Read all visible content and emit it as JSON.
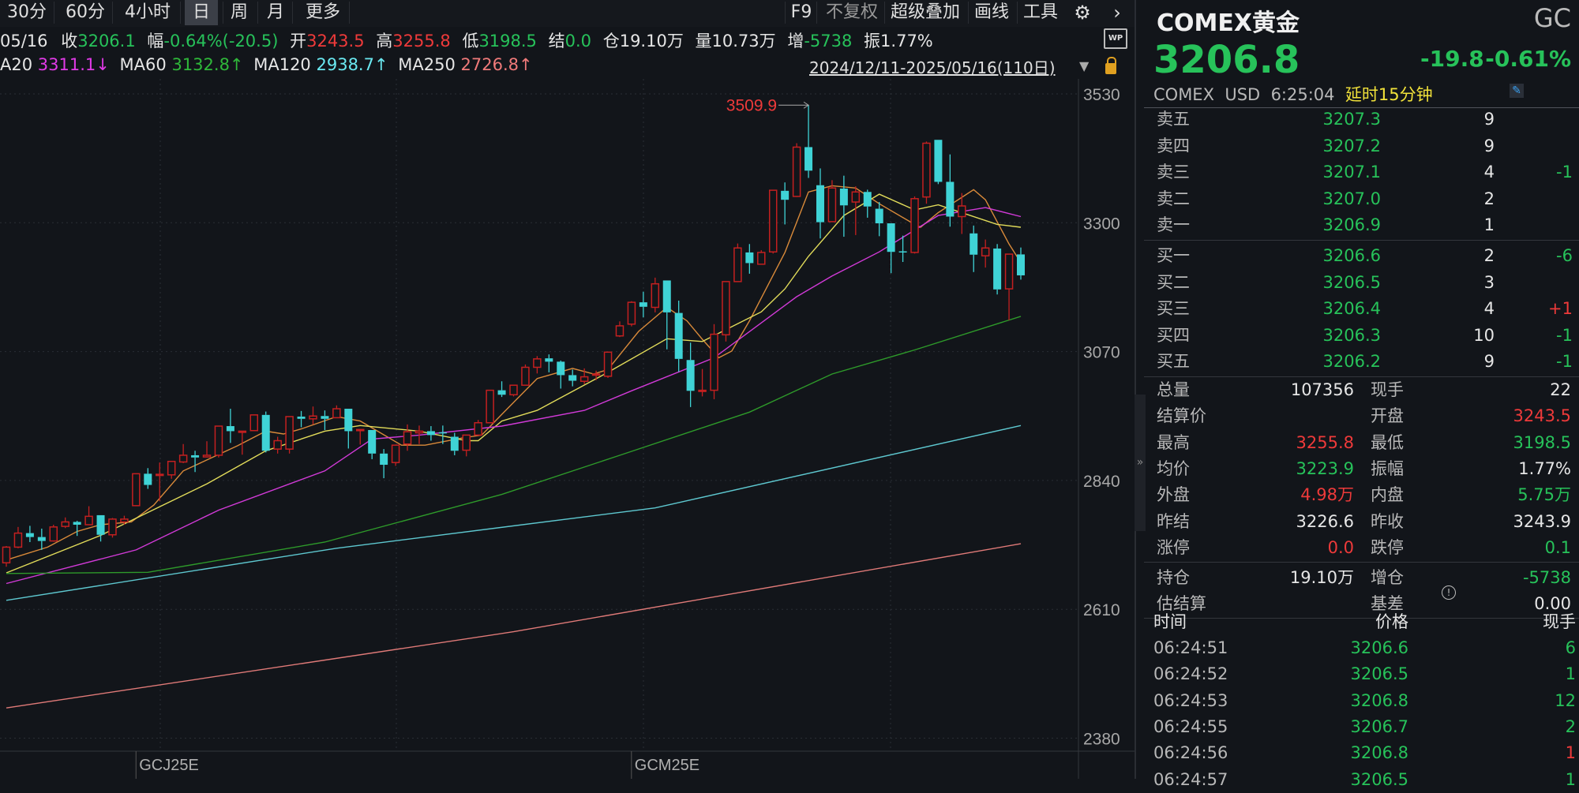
{
  "toolbar": {
    "periods": [
      "30分",
      "60分",
      "4小时",
      "日",
      "周",
      "月",
      "更多"
    ],
    "selected": "日",
    "right_items": [
      "F9",
      "不复权",
      "超级叠加",
      "画线",
      "工具"
    ],
    "gear_icon": "gear-icon",
    "next_icon": "chevron-right-icon"
  },
  "info": {
    "date": "05/16",
    "close_label": "收",
    "close": "3206.1",
    "chg_label": "幅",
    "chg": "-0.64%(-20.5)",
    "open_label": "开",
    "open": "3243.5",
    "high_label": "高",
    "high": "3255.8",
    "low_label": "低",
    "low": "3198.5",
    "settle_label": "结",
    "settle": "0.0",
    "oi": "仓19.10万",
    "vol": "量10.73万",
    "inc_label": "增",
    "inc": "-5738",
    "amp": "振1.77%"
  },
  "ma_row": {
    "ma20_label": "A20",
    "ma20": "3311.1↓",
    "ma60_label": "MA60",
    "ma60": "3132.8↑",
    "ma120_label": "MA120",
    "ma120": "2938.7↑",
    "ma250_label": "MA250",
    "ma250": "2726.8↑",
    "range": "2024/12/11-2025/05/16(110日)"
  },
  "colors": {
    "up": "#c42020",
    "down": "#3fd3d6",
    "green": "#27c25a",
    "red": "#ee3a3a",
    "ma5": "#d98a3a",
    "ma10": "#e2dc5a",
    "ma20": "#d23ad8",
    "ma60": "#2e9a2a",
    "ma120": "#5ec8d0",
    "ma250": "#e07a78"
  },
  "chart_data": {
    "type": "candlestick",
    "ylim": [
      2380,
      3530
    ],
    "yticks": [
      "3530",
      "3300",
      "3070",
      "2840",
      "2610",
      "2380"
    ],
    "xlabels": [
      {
        "text": "GCJ25E",
        "index": 13
      },
      {
        "text": "GCM25E",
        "index": 55
      }
    ],
    "max_label": "3509.9",
    "max_index": 68,
    "candles": [
      [
        2693,
        2723,
        2686,
        2721
      ],
      [
        2721,
        2757,
        2719,
        2746
      ],
      [
        2746,
        2759,
        2730,
        2739
      ],
      [
        2739,
        2754,
        2716,
        2732
      ],
      [
        2732,
        2761,
        2731,
        2757
      ],
      [
        2758,
        2774,
        2755,
        2766
      ],
      [
        2766,
        2768,
        2741,
        2761
      ],
      [
        2761,
        2794,
        2761,
        2776
      ],
      [
        2778,
        2778,
        2731,
        2743
      ],
      [
        2743,
        2773,
        2738,
        2771
      ],
      [
        2766,
        2777,
        2761,
        2771
      ],
      [
        2795,
        2852,
        2794,
        2852
      ],
      [
        2852,
        2862,
        2825,
        2832
      ],
      [
        2849,
        2872,
        2803,
        2851
      ],
      [
        2850,
        2875,
        2843,
        2874
      ],
      [
        2873,
        2905,
        2871,
        2885
      ],
      [
        2885,
        2893,
        2855,
        2881
      ],
      [
        2882,
        2910,
        2881,
        2885
      ],
      [
        2885,
        2937,
        2881,
        2937
      ],
      [
        2937,
        2968,
        2907,
        2928
      ],
      [
        2926,
        2928,
        2886,
        2928
      ],
      [
        2929,
        2957,
        2929,
        2957
      ],
      [
        2957,
        2963,
        2890,
        2893
      ],
      [
        2896,
        2918,
        2888,
        2911
      ],
      [
        2896,
        2954,
        2888,
        2954
      ],
      [
        2954,
        2964,
        2935,
        2950
      ],
      [
        2950,
        2972,
        2940,
        2955
      ],
      [
        2955,
        2965,
        2930,
        2950
      ],
      [
        2952,
        2974,
        2952,
        2968
      ],
      [
        2968,
        2968,
        2897,
        2928
      ],
      [
        2930,
        2931,
        2904,
        2931
      ],
      [
        2930,
        2930,
        2878,
        2888
      ],
      [
        2888,
        2896,
        2844,
        2868
      ],
      [
        2872,
        2903,
        2866,
        2903
      ],
      [
        2905,
        2940,
        2893,
        2927
      ],
      [
        2925,
        2938,
        2905,
        2928
      ],
      [
        2928,
        2937,
        2911,
        2921
      ],
      [
        2926,
        2938,
        2905,
        2925
      ],
      [
        2918,
        2925,
        2885,
        2893
      ],
      [
        2894,
        2921,
        2883,
        2921
      ],
      [
        2921,
        2948,
        2921,
        2943
      ],
      [
        2943,
        3001,
        2943,
        3001
      ],
      [
        3001,
        3017,
        2989,
        2993
      ],
      [
        2993,
        3010,
        2990,
        3010
      ],
      [
        3010,
        3047,
        3010,
        3042
      ],
      [
        3042,
        3062,
        3031,
        3057
      ],
      [
        3058,
        3065,
        3033,
        3052
      ],
      [
        3052,
        3054,
        3004,
        3028
      ],
      [
        3028,
        3038,
        3008,
        3018
      ],
      [
        3017,
        3040,
        3012,
        3025
      ],
      [
        3029,
        3036,
        3019,
        3030
      ],
      [
        3026,
        3070,
        3023,
        3069
      ],
      [
        3098,
        3124,
        3096,
        3116
      ],
      [
        3119,
        3160,
        3115,
        3158
      ],
      [
        3158,
        3177,
        3131,
        3150
      ],
      [
        3149,
        3202,
        3140,
        3191
      ],
      [
        3197,
        3197,
        3074,
        3140
      ],
      [
        3139,
        3161,
        3034,
        3057
      ],
      [
        3055,
        3086,
        2971,
        3000
      ],
      [
        2999,
        3039,
        2990,
        3001
      ],
      [
        3001,
        3119,
        2985,
        3101
      ],
      [
        3100,
        3195,
        3088,
        3195
      ],
      [
        3195,
        3263,
        3195,
        3255
      ],
      [
        3247,
        3262,
        3209,
        3228
      ],
      [
        3226,
        3251,
        3226,
        3247
      ],
      [
        3248,
        3358,
        3245,
        3358
      ],
      [
        3357,
        3372,
        3297,
        3341
      ],
      [
        3347,
        3442,
        3346,
        3435
      ],
      [
        3435,
        3509.9,
        3380,
        3393
      ],
      [
        3367,
        3397,
        3272,
        3301
      ],
      [
        3302,
        3376,
        3301,
        3362
      ],
      [
        3361,
        3384,
        3275,
        3331
      ],
      [
        3337,
        3365,
        3278,
        3355
      ],
      [
        3355,
        3359,
        3309,
        3329
      ],
      [
        3325,
        3337,
        3276,
        3299
      ],
      [
        3299,
        3299,
        3210,
        3248
      ],
      [
        3249,
        3277,
        3230,
        3247
      ],
      [
        3247,
        3347,
        3245,
        3343
      ],
      [
        3346,
        3445,
        3334,
        3442
      ],
      [
        3448,
        3448,
        3369,
        3373
      ],
      [
        3373,
        3422,
        3293,
        3311
      ],
      [
        3311,
        3353,
        3280,
        3330
      ],
      [
        3281,
        3295,
        3212,
        3243
      ],
      [
        3241,
        3270,
        3220,
        3255
      ],
      [
        3254,
        3262,
        3172,
        3181
      ],
      [
        3182,
        3244,
        3126,
        3244
      ],
      [
        3243.5,
        3255.8,
        3198.5,
        3206.1
      ]
    ],
    "ma_series": [
      {
        "name": "MA5",
        "color_key": "ma5",
        "points": [
          [
            0,
            2698
          ],
          [
            3.5,
            2721
          ],
          [
            6,
            2749
          ],
          [
            8,
            2761
          ],
          [
            10.6,
            2766
          ],
          [
            12.5,
            2796
          ],
          [
            15,
            2857
          ],
          [
            19.6,
            2902
          ],
          [
            22,
            2928
          ],
          [
            23.5,
            2923
          ],
          [
            25,
            2932
          ],
          [
            28,
            2954
          ],
          [
            30,
            2946
          ],
          [
            33.5,
            2903
          ],
          [
            35.5,
            2903
          ],
          [
            38.7,
            2916
          ],
          [
            40.3,
            2921
          ],
          [
            42,
            2958
          ],
          [
            45,
            3022
          ],
          [
            48,
            3040
          ],
          [
            49.8,
            3030
          ],
          [
            51,
            3038
          ],
          [
            53.6,
            3106
          ],
          [
            56,
            3149
          ],
          [
            57.7,
            3125
          ],
          [
            59,
            3092
          ],
          [
            60.4,
            3059
          ],
          [
            61.5,
            3071
          ],
          [
            63,
            3125
          ],
          [
            66,
            3247
          ],
          [
            68,
            3355
          ],
          [
            70,
            3366
          ],
          [
            72,
            3362
          ],
          [
            74,
            3334
          ],
          [
            77,
            3297
          ],
          [
            77.5,
            3292
          ],
          [
            79,
            3318
          ],
          [
            82,
            3359
          ],
          [
            83,
            3341
          ],
          [
            85,
            3262
          ],
          [
            86,
            3229
          ]
        ]
      },
      {
        "name": "MA10",
        "color_key": "ma10",
        "points": [
          [
            0,
            2675
          ],
          [
            8,
            2742
          ],
          [
            17,
            2834
          ],
          [
            22,
            2893
          ],
          [
            27,
            2928
          ],
          [
            30,
            2938
          ],
          [
            35,
            2928
          ],
          [
            39,
            2911
          ],
          [
            40,
            2911
          ],
          [
            42,
            2946
          ],
          [
            45,
            2965
          ],
          [
            51,
            3033
          ],
          [
            56,
            3093
          ],
          [
            59,
            3088
          ],
          [
            64,
            3141
          ],
          [
            66,
            3182
          ],
          [
            68,
            3240
          ],
          [
            71,
            3313
          ],
          [
            74,
            3351
          ],
          [
            77,
            3323
          ],
          [
            79,
            3332
          ],
          [
            84,
            3297
          ],
          [
            86,
            3292
          ]
        ]
      },
      {
        "name": "MA20",
        "color_key": "ma20",
        "points": [
          [
            0,
            2656
          ],
          [
            11,
            2716
          ],
          [
            18,
            2787
          ],
          [
            27,
            2857
          ],
          [
            31,
            2914
          ],
          [
            35,
            2921
          ],
          [
            42,
            2937
          ],
          [
            49,
            2965
          ],
          [
            53,
            3000
          ],
          [
            60,
            3059
          ],
          [
            67,
            3168
          ],
          [
            70,
            3205
          ],
          [
            74,
            3248
          ],
          [
            79,
            3313
          ],
          [
            83,
            3327
          ],
          [
            86,
            3311
          ]
        ]
      },
      {
        "name": "MA60",
        "color_key": "ma60",
        "points": [
          [
            0,
            2674
          ],
          [
            12,
            2676
          ],
          [
            27,
            2730
          ],
          [
            42,
            2815
          ],
          [
            52,
            2885
          ],
          [
            63,
            2962
          ],
          [
            70,
            3030
          ],
          [
            77,
            3073
          ],
          [
            86,
            3133
          ]
        ]
      },
      {
        "name": "MA120",
        "color_key": "ma120",
        "points": [
          [
            0,
            2626
          ],
          [
            28,
            2719
          ],
          [
            55,
            2791
          ],
          [
            86,
            2938
          ]
        ]
      },
      {
        "name": "MA250",
        "color_key": "ma250",
        "points": [
          [
            0,
            2434
          ],
          [
            43,
            2570
          ],
          [
            86,
            2727
          ]
        ]
      }
    ]
  },
  "panel": {
    "name": "COMEX黄金",
    "code": "GC",
    "price": "3206.8",
    "change": "-19.8",
    "pct": "-0.61%",
    "exchange": "COMEX",
    "currency": "USD",
    "time": "6:25:04",
    "delay": "延时15分钟",
    "asks": [
      {
        "label": "卖五",
        "price": "3207.3",
        "qty": "9",
        "chg": ""
      },
      {
        "label": "卖四",
        "price": "3207.2",
        "qty": "9",
        "chg": ""
      },
      {
        "label": "卖三",
        "price": "3207.1",
        "qty": "4",
        "chg": "-1"
      },
      {
        "label": "卖二",
        "price": "3207.0",
        "qty": "2",
        "chg": ""
      },
      {
        "label": "卖一",
        "price": "3206.9",
        "qty": "1",
        "chg": ""
      }
    ],
    "bids": [
      {
        "label": "买一",
        "price": "3206.6",
        "qty": "2",
        "chg": "-6"
      },
      {
        "label": "买二",
        "price": "3206.5",
        "qty": "3",
        "chg": ""
      },
      {
        "label": "买三",
        "price": "3206.4",
        "qty": "4",
        "chg": "+1"
      },
      {
        "label": "买四",
        "price": "3206.3",
        "qty": "10",
        "chg": "-1"
      },
      {
        "label": "买五",
        "price": "3206.2",
        "qty": "9",
        "chg": "-1"
      }
    ],
    "stats": [
      {
        "l1": "总量",
        "v1": "107356",
        "c1": "w",
        "l2": "现手",
        "v2": "22",
        "c2": "w"
      },
      {
        "l1": "结算价",
        "v1": "",
        "c1": "w",
        "l2": "开盘",
        "v2": "3243.5",
        "c2": "r"
      },
      {
        "l1": "最高",
        "v1": "3255.8",
        "c1": "r",
        "l2": "最低",
        "v2": "3198.5",
        "c2": "g"
      },
      {
        "l1": "均价",
        "v1": "3223.9",
        "c1": "g",
        "l2": "振幅",
        "v2": "1.77%",
        "c2": "w"
      },
      {
        "l1": "外盘",
        "v1": "4.98万",
        "c1": "r",
        "l2": "内盘",
        "v2": "5.75万",
        "c2": "g"
      },
      {
        "l1": "昨结",
        "v1": "3226.6",
        "c1": "w",
        "l2": "昨收",
        "v2": "3243.9",
        "c2": "w"
      },
      {
        "l1": "涨停",
        "v1": "0.0",
        "c1": "r",
        "l2": "跌停",
        "v2": "0.1",
        "c2": "g"
      }
    ],
    "stats2": [
      {
        "l1": "持仓",
        "v1": "19.10万",
        "c1": "w",
        "l2": "增仓",
        "v2": "-5738",
        "c2": "g"
      },
      {
        "l1": "估结算",
        "v1": "",
        "c1": "w",
        "l2": "基差",
        "v2": "0.00",
        "c2": "w"
      }
    ],
    "trade_header": {
      "time": "时间",
      "price": "价格",
      "qty": "现手"
    },
    "trades": [
      {
        "time": "06:24:51",
        "price": "3206.6",
        "qty": "6",
        "c": "g"
      },
      {
        "time": "06:24:52",
        "price": "3206.5",
        "qty": "1",
        "c": "g"
      },
      {
        "time": "06:24:53",
        "price": "3206.8",
        "qty": "12",
        "c": "g"
      },
      {
        "time": "06:24:55",
        "price": "3206.7",
        "qty": "2",
        "c": "g"
      },
      {
        "time": "06:24:56",
        "price": "3206.8",
        "qty": "1",
        "c": "r"
      },
      {
        "time": "06:24:57",
        "price": "3206.5",
        "qty": "1",
        "c": "g"
      }
    ]
  }
}
